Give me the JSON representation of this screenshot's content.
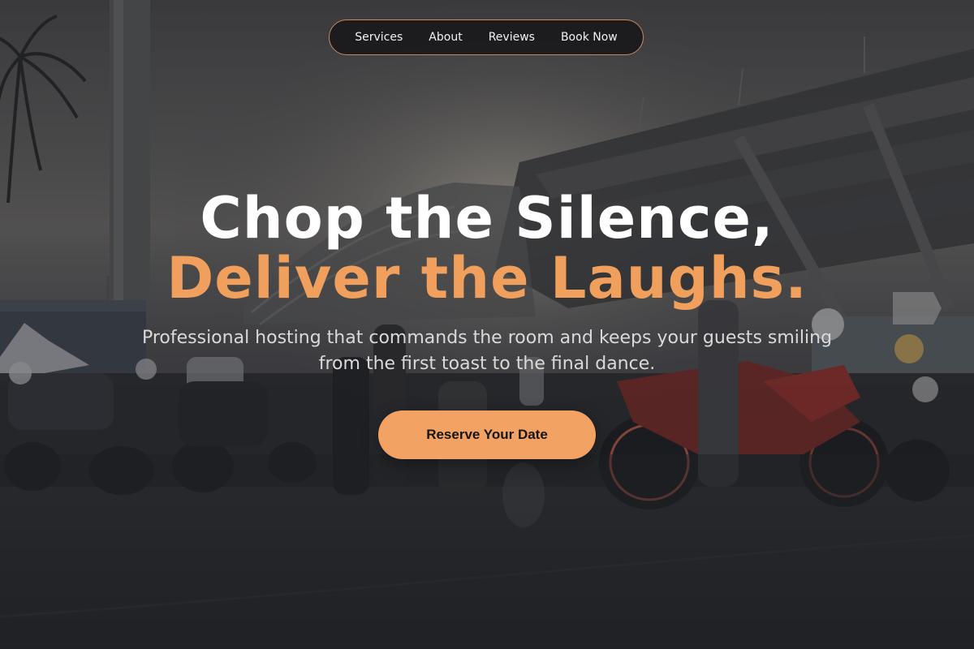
{
  "nav": {
    "items": [
      {
        "label": "Services"
      },
      {
        "label": "About"
      },
      {
        "label": "Reviews"
      },
      {
        "label": "Book Now"
      }
    ]
  },
  "hero": {
    "title_line1": "Chop the Silence,",
    "title_line2": "Deliver the Laughs.",
    "subtitle": "Professional hosting that commands the room and keeps your guests smiling from the first toast to the final dance.",
    "cta_label": "Reserve Your Date",
    "background_image": "stadium-parking-with-motorbikes"
  },
  "colors": {
    "accent": "#f0a05c",
    "cta_bg": "#f2a262",
    "nav_border": "#c7895a",
    "nav_bg": "#18181a",
    "title_white": "#ffffff"
  }
}
